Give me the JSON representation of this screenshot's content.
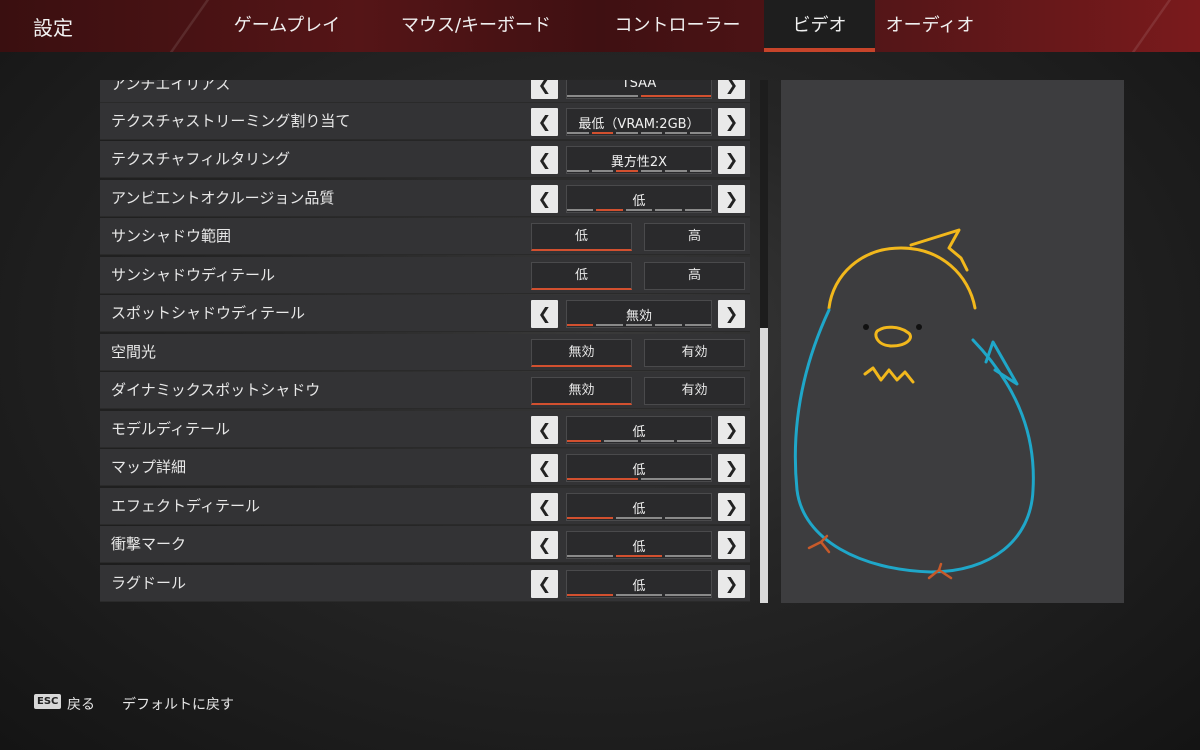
{
  "header": {
    "title": "設定",
    "tabs": [
      {
        "label": "ゲームプレイ",
        "active": false
      },
      {
        "label": "マウス/キーボード",
        "active": false
      },
      {
        "label": "コントローラー",
        "active": false
      },
      {
        "label": "ビデオ",
        "active": true
      },
      {
        "label": "オーディオ",
        "active": false
      }
    ]
  },
  "settings": [
    {
      "label": "アンチエイリアス",
      "type": "selector",
      "value": "TSAA"
    },
    {
      "label": "テクスチャストリーミング割り当て",
      "type": "selector",
      "value": "最低（VRAM:2GB）"
    },
    {
      "label": "テクスチャフィルタリング",
      "type": "selector",
      "value": "異方性2X"
    },
    {
      "label": "アンビエントオクルージョン品質",
      "type": "selector",
      "value": "低"
    },
    {
      "label": "サンシャドウ範囲",
      "type": "toggle",
      "options": [
        "低",
        "高"
      ],
      "selected": 0
    },
    {
      "label": "サンシャドウディテール",
      "type": "toggle",
      "options": [
        "低",
        "高"
      ],
      "selected": 0
    },
    {
      "label": "スポットシャドウディテール",
      "type": "selector",
      "value": "無効"
    },
    {
      "label": "空間光",
      "type": "toggle",
      "options": [
        "無効",
        "有効"
      ],
      "selected": 0
    },
    {
      "label": "ダイナミックスポットシャドウ",
      "type": "toggle",
      "options": [
        "無効",
        "有効"
      ],
      "selected": 0
    },
    {
      "label": "モデルディテール",
      "type": "selector",
      "value": "低"
    },
    {
      "label": "マップ詳細",
      "type": "selector",
      "value": "低"
    },
    {
      "label": "エフェクトディテール",
      "type": "selector",
      "value": "低"
    },
    {
      "label": "衝撃マーク",
      "type": "selector",
      "value": "低"
    },
    {
      "label": "ラグドール",
      "type": "selector",
      "value": "低"
    }
  ],
  "arrows": {
    "left": "❮",
    "right": "❯"
  },
  "footer": {
    "esc_key": "ESC",
    "back_label": "戻る",
    "default_label": "デフォルトに戻す"
  },
  "colors": {
    "accent": "#d2502f",
    "preview_blue": "#1fa7c9",
    "preview_yellow": "#f2b81c",
    "preview_orange": "#c75a2a"
  }
}
